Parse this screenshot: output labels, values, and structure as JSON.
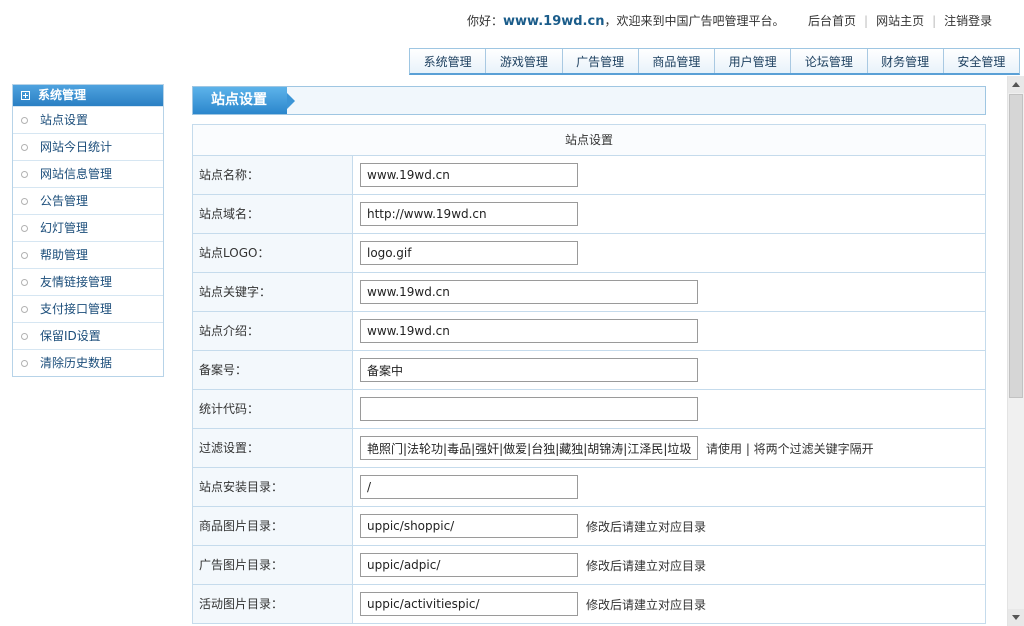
{
  "header": {
    "greeting_prefix": "你好：",
    "site_name": "www.19wd.cn",
    "greeting_suffix": "，欢迎来到中国广告吧管理平台。",
    "links": [
      "后台首页",
      "网站主页",
      "注销登录"
    ]
  },
  "nav": {
    "tabs": [
      "系统管理",
      "游戏管理",
      "广告管理",
      "商品管理",
      "用户管理",
      "论坛管理",
      "财务管理",
      "安全管理"
    ]
  },
  "sidebar": {
    "title": "系统管理",
    "items": [
      "站点设置",
      "网站今日统计",
      "网站信息管理",
      "公告管理",
      "幻灯管理",
      "帮助管理",
      "友情链接管理",
      "支付接口管理",
      "保留ID设置",
      "清除历史数据"
    ]
  },
  "page": {
    "title": "站点设置"
  },
  "form": {
    "heading": "站点设置",
    "rows": [
      {
        "label": "站点名称：",
        "value": "www.19wd.cn",
        "hint": ""
      },
      {
        "label": "站点域名：",
        "value": "http://www.19wd.cn",
        "hint": ""
      },
      {
        "label": "站点LOGO：",
        "value": "logo.gif",
        "hint": ""
      },
      {
        "label": "站点关键字：",
        "value": "www.19wd.cn",
        "hint": ""
      },
      {
        "label": "站点介绍：",
        "value": "www.19wd.cn",
        "hint": ""
      },
      {
        "label": "备案号：",
        "value": "备案中",
        "hint": ""
      },
      {
        "label": "统计代码：",
        "value": "",
        "hint": ""
      },
      {
        "label": "过滤设置：",
        "value": "艳照门|法轮功|毒品|强奸|做爱|台独|藏独|胡锦涛|江泽民|垃圾",
        "hint": "请使用 | 将两个过滤关键字隔开"
      },
      {
        "label": "站点安装目录：",
        "value": "/",
        "hint": ""
      },
      {
        "label": "商品图片目录：",
        "value": "uppic/shoppic/",
        "hint": "修改后请建立对应目录"
      },
      {
        "label": "广告图片目录：",
        "value": "uppic/adpic/",
        "hint": "修改后请建立对应目录"
      },
      {
        "label": "活动图片目录：",
        "value": "uppic/activitiespic/",
        "hint": "修改后请建立对应目录"
      }
    ]
  }
}
